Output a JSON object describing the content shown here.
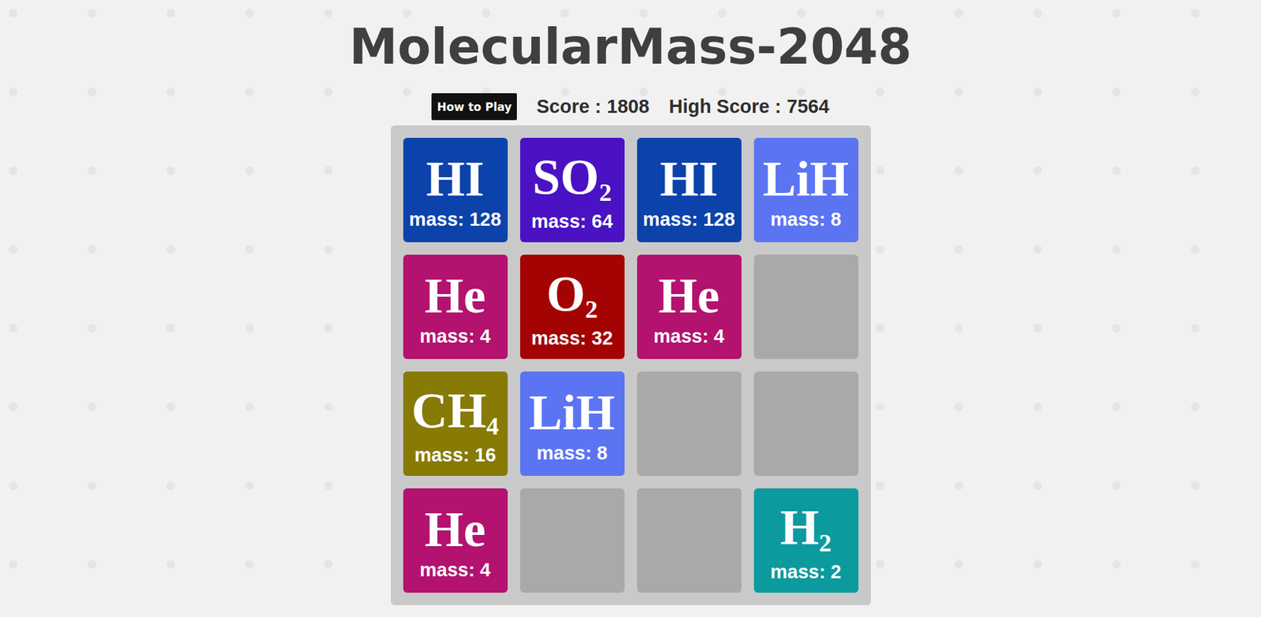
{
  "title": "MolecularMass-2048",
  "header": {
    "howToPlay": "How to Play",
    "score": {
      "label": "Score :",
      "value": "1808"
    },
    "highScore": {
      "label": "High Score :",
      "value": "7564"
    }
  },
  "board": {
    "rows": [
      [
        {
          "kind": "tile",
          "symbol": "HI",
          "mass": "mass: 128",
          "color": "#0b43ab"
        },
        {
          "kind": "tile",
          "symbol": "SO",
          "subscript": "2",
          "mass": "mass: 64",
          "color": "#4a12c2"
        },
        {
          "kind": "tile",
          "symbol": "HI",
          "mass": "mass: 128",
          "color": "#0b43ab"
        },
        {
          "kind": "tile",
          "symbol": "LiH",
          "mass": "mass: 8",
          "color": "#5b74f2"
        }
      ],
      [
        {
          "kind": "tile",
          "symbol": "He",
          "mass": "mass: 4",
          "color": "#b3126f"
        },
        {
          "kind": "tile",
          "symbol": "O",
          "subscript": "2",
          "mass": "mass: 32",
          "color": "#a30303"
        },
        {
          "kind": "tile",
          "symbol": "He",
          "mass": "mass: 4",
          "color": "#b3126f"
        },
        {
          "kind": "empty"
        }
      ],
      [
        {
          "kind": "tile",
          "symbol": "CH",
          "subscript": "4",
          "mass": "mass: 16",
          "color": "#877a05"
        },
        {
          "kind": "tile",
          "symbol": "LiH",
          "mass": "mass: 8",
          "color": "#5b74f2"
        },
        {
          "kind": "empty"
        },
        {
          "kind": "empty"
        }
      ],
      [
        {
          "kind": "tile",
          "symbol": "He",
          "mass": "mass: 4",
          "color": "#b3126f"
        },
        {
          "kind": "empty"
        },
        {
          "kind": "empty"
        },
        {
          "kind": "tile",
          "symbol": "H",
          "subscript": "2",
          "mass": "mass: 2",
          "color": "#0b9a9e"
        }
      ]
    ]
  }
}
